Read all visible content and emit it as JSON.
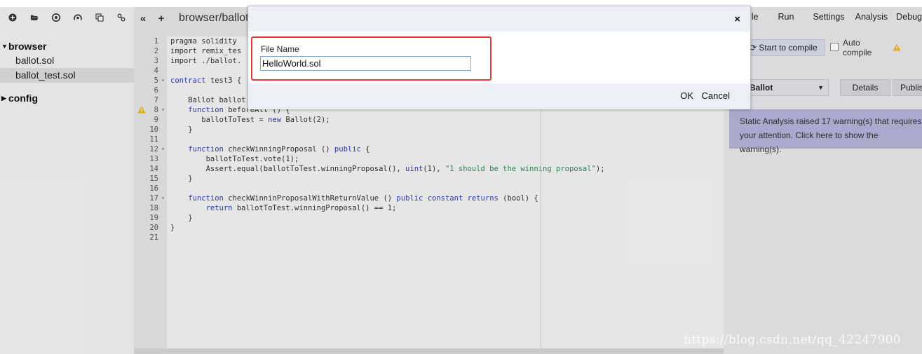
{
  "file_panel": {
    "toolbar_icons": [
      "plus-icon",
      "folder-open-icon",
      "github-icon",
      "github-alt-icon",
      "copy-icon",
      "link-icon"
    ],
    "tree": [
      {
        "label": "browser",
        "expanded": true,
        "files": [
          "ballot.sol",
          "ballot_test.sol"
        ],
        "active_file": "ballot_test.sol"
      },
      {
        "label": "config",
        "expanded": false,
        "files": []
      }
    ]
  },
  "editor": {
    "tab_label": "browser/ballot.",
    "nav_icons": [
      "double-chevron-left-icon",
      "plus-icon"
    ],
    "line_numbers": [
      "1",
      "2",
      "3",
      "4",
      "5",
      "6",
      "7",
      "8",
      "9",
      "10",
      "11",
      "12",
      "13",
      "14",
      "15",
      "16",
      "17",
      "18",
      "19",
      "20",
      "21"
    ],
    "code_lines": [
      "pragma solidity",
      "import \"remix_tes",
      "import \"./ballot.",
      "",
      "contract test3 {",
      "",
      "    Ballot ballot",
      "    function beforeAll () {",
      "       ballotToTest = new Ballot(2);",
      "    }",
      "",
      "    function checkWinningProposal () public {",
      "        ballotToTest.vote(1);",
      "        Assert.equal(ballotToTest.winningProposal(), uint(1), \"1 should be the winning proposal\");",
      "    }",
      "",
      "    function checkWinninProposalWithReturnValue () public constant returns (bool) {",
      "        return ballotToTest.winningProposal() == 1;",
      "    }",
      "}",
      ""
    ],
    "warning_line": "8"
  },
  "right_panel": {
    "tabs": [
      "ile",
      "Run",
      "Settings",
      "Analysis",
      "Debugg"
    ],
    "compile_button": "Start to compile",
    "auto_compile_label": "Auto compile",
    "contract_select": "Ballot",
    "details_button": "Details",
    "publish_button": "Publis",
    "static_analysis_message": "Static Analysis raised 17 warning(s) that requires your attention. Click here to show the warning(s)."
  },
  "modal": {
    "field_label": "File Name",
    "input_value": "HelloWorld.sol",
    "ok_label": "OK",
    "cancel_label": "Cancel",
    "close_label": "×"
  },
  "watermark": "https://blog.csdn.net/qq_42247900",
  "colors": {
    "highlight_border": "#e53935",
    "warning_box_bg": "#b4b1d8",
    "keyword": "#2a3fb5",
    "string": "#2d8a4e"
  }
}
